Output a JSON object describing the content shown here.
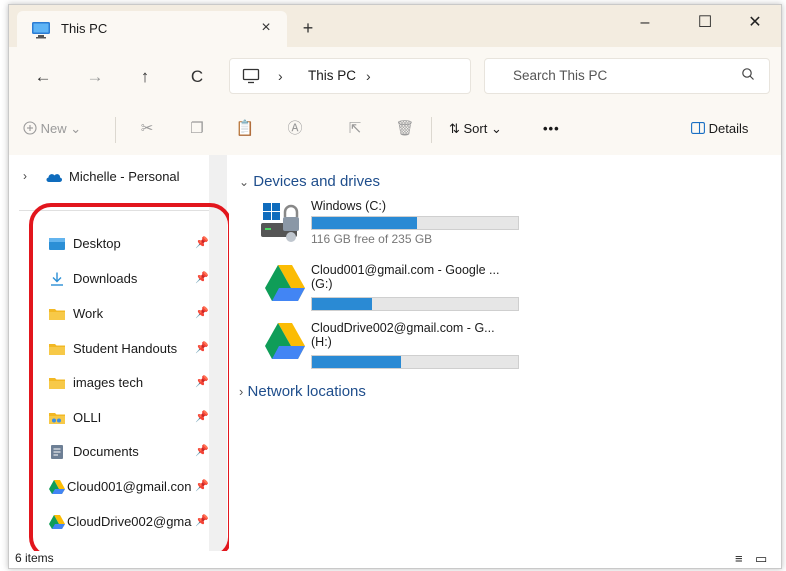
{
  "window": {
    "tab_title": "This PC",
    "tab_close": "×",
    "new_tab": "+",
    "minimize": "–",
    "maximize": "☐",
    "close": "✕"
  },
  "navigation": {
    "back": "←",
    "forward": "→",
    "up": "↑",
    "refresh": "C",
    "breadcrumb_sep": "›",
    "breadcrumb": "This PC",
    "breadcrumb_sep2": "›",
    "search_placeholder": "Search This PC",
    "search_icon": "search-icon"
  },
  "commandbar": {
    "new_label": "New",
    "sort_label": "Sort",
    "more_label": "•••",
    "details_label": "Details"
  },
  "sidebar": {
    "account": "Michelle - Personal",
    "items": [
      {
        "label": "Desktop",
        "icon": "desktop-folder-icon",
        "pinned": true
      },
      {
        "label": "Downloads",
        "icon": "downloads-icon",
        "pinned": true
      },
      {
        "label": "Work",
        "icon": "folder-icon",
        "pinned": true
      },
      {
        "label": "Student Handouts",
        "icon": "folder-icon",
        "pinned": true
      },
      {
        "label": "images tech",
        "icon": "folder-icon",
        "pinned": true
      },
      {
        "label": "OLLI",
        "icon": "folder-icon",
        "pinned": true
      },
      {
        "label": "Documents",
        "icon": "documents-icon",
        "pinned": true
      },
      {
        "label": "Cloud001@gmail.con",
        "icon": "google-drive-icon",
        "pinned": true
      },
      {
        "label": "CloudDrive002@gma",
        "icon": "google-drive-icon",
        "pinned": true
      }
    ],
    "highlight_color": "#e2161d"
  },
  "content": {
    "group_devices": "Devices and drives",
    "group_network": "Network locations",
    "drives": [
      {
        "name": "Windows (C:)",
        "line2": "",
        "free_text": "116 GB free of 235 GB",
        "used_fraction": 0.51,
        "icon": "windows-drive-icon"
      },
      {
        "name": "Cloud001@gmail.com - Google ...",
        "line2": "(G:)",
        "free_text": "",
        "used_fraction": 0.29,
        "icon": "google-drive-icon"
      },
      {
        "name": "CloudDrive002@gmail.com - G...",
        "line2": "(H:)",
        "free_text": "",
        "used_fraction": 0.43,
        "icon": "google-drive-icon"
      }
    ],
    "bar_color": "#2a8ad4"
  },
  "status": {
    "item_count": "6 items"
  }
}
